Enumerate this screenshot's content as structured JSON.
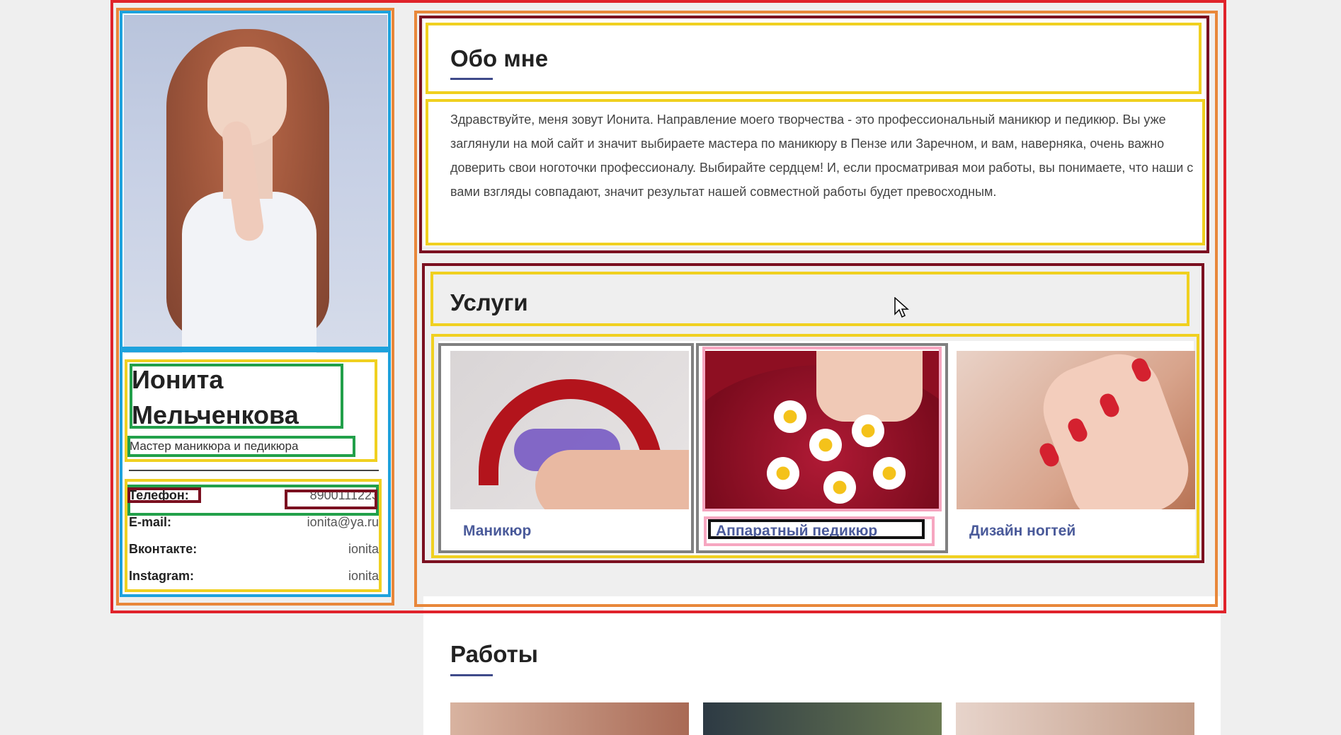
{
  "profile": {
    "name_line1": "Ионита",
    "name_line2": "Мельченкова",
    "subtitle": "Мастер маникюра и педикюра",
    "contacts": [
      {
        "key": "Телефон:",
        "value": "8900111223"
      },
      {
        "key": "E-mail:",
        "value": "ionita@ya.ru"
      },
      {
        "key": "Вконтакте:",
        "value": "ionita"
      },
      {
        "key": "Instagram:",
        "value": "ionita"
      }
    ]
  },
  "about": {
    "title": "Обо мне",
    "text": "Здравствуйте, меня зовут Ионита. Направление моего творчества - это профессиональный маникюр и педикюр. Вы уже заглянули на мой сайт и значит выбираете мастера по маникюру в Пензе или Заречном, и вам, наверняка, очень важно доверить свои ноготочки профессионалу. Выбирайте сердцем! И, если просматривая мои работы, вы понимаете, что наши с вами взгляды совпадают, значит результат нашей совместной работы будет превосходным."
  },
  "services": {
    "title": "Услуги",
    "items": [
      {
        "label": "Маникюр",
        "image": "manicure-lamp-photo"
      },
      {
        "label": "Аппаратный педикюр",
        "image": "pedicure-flowers-photo"
      },
      {
        "label": "Дизайн ногтей",
        "image": "red-nails-photo"
      }
    ]
  },
  "works": {
    "title": "Работы"
  },
  "colors": {
    "accent": "#3f4a8a",
    "link": "#4a5a9a",
    "page_bg": "#efefef"
  }
}
